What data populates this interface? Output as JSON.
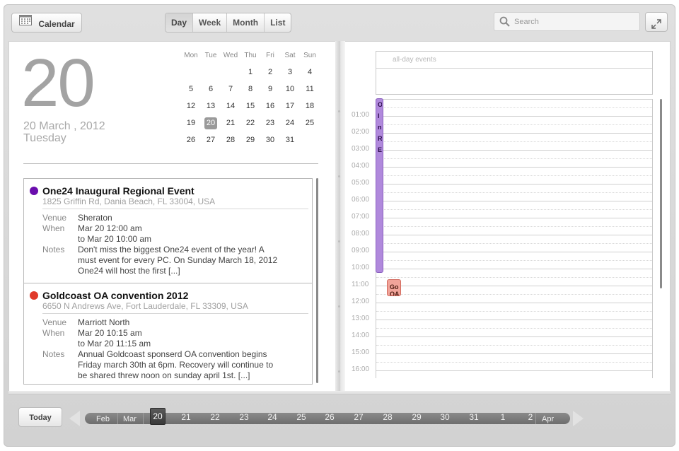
{
  "toolbar": {
    "calendar_label": "Calendar",
    "views": [
      "Day",
      "Week",
      "Month",
      "List"
    ],
    "active_view": "Day",
    "search_placeholder": "Search"
  },
  "day": {
    "big_number": "20",
    "full_date": "20 March , 2012",
    "weekday": "Tuesday"
  },
  "mini_calendar": {
    "weekdays": [
      "Mon",
      "Tue",
      "Wed",
      "Thu",
      "Fri",
      "Sat",
      "Sun"
    ],
    "weeks": [
      [
        "",
        "",
        "",
        "1",
        "2",
        "3",
        "4"
      ],
      [
        "5",
        "6",
        "7",
        "8",
        "9",
        "10",
        "11"
      ],
      [
        "12",
        "13",
        "14",
        "15",
        "16",
        "17",
        "18"
      ],
      [
        "19",
        "20",
        "21",
        "22",
        "23",
        "24",
        "25"
      ],
      [
        "26",
        "27",
        "28",
        "29",
        "30",
        "31",
        ""
      ]
    ],
    "selected": "20"
  },
  "events": [
    {
      "color": "#6a0dad",
      "title": "One24 Inaugural Regional Event",
      "address": "1825 Griffin Rd, Dania Beach, FL 33004, USA",
      "venue_label": "Venue",
      "venue": "Sheraton",
      "when_label": "When",
      "when_start": "Mar 20 12:00 am",
      "when_end": "to Mar 20 10:00 am",
      "notes_label": "Notes",
      "notes": "Don't miss the biggest One24 event of the year! A must event for every PC. On Sunday March 18, 2012 One24 will host the first [...]"
    },
    {
      "color": "#e03a2a",
      "title": "Goldcoast OA convention 2012",
      "address": "6650 N Andrews Ave, Fort Lauderdale, FL 33309, USA",
      "venue_label": "Venue",
      "venue": "Marriott North",
      "when_label": "When",
      "when_start": "Mar 20 10:15 am",
      "when_end": "to Mar 20 11:15 am",
      "notes_label": "Notes",
      "notes": "  Annual Goldcoast sponserd OA convention begins Friday march 30th at 6pm. Recovery will continue to be shared threw noon on sunday april 1st. [...]"
    }
  ],
  "day_view": {
    "all_day_label": "all-day events",
    "hours": [
      "01:00",
      "02:00",
      "03:00",
      "04:00",
      "05:00",
      "06:00",
      "07:00",
      "08:00",
      "09:00",
      "10:00",
      "11:00",
      "12:00",
      "13:00",
      "14:00",
      "15:00",
      "16:00"
    ],
    "event1_text": "O\nIn\nR\nE",
    "event2_text": "Go\nOA"
  },
  "timeline": {
    "today_label": "Today",
    "months": [
      "Feb",
      "Mar",
      "Apr"
    ],
    "days": [
      "20",
      "21",
      "22",
      "23",
      "24",
      "25",
      "26",
      "27",
      "28",
      "29",
      "30",
      "31",
      "1",
      "2"
    ],
    "selected_day": "20"
  }
}
